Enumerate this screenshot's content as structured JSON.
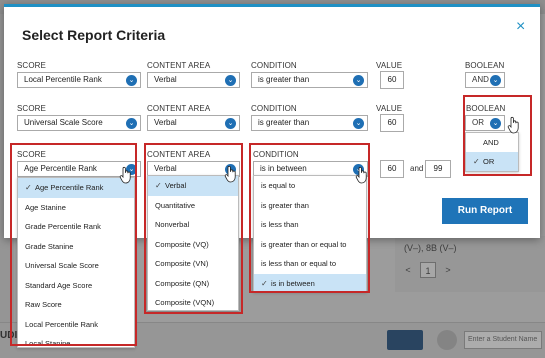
{
  "dialog": {
    "title": "Select Report Criteria",
    "close_glyph": "×",
    "run_button": "Run Report"
  },
  "rows": [
    {
      "score_label": "SCORE",
      "score_value": "Local Percentile Rank",
      "content_label": "CONTENT AREA",
      "content_value": "Verbal",
      "condition_label": "CONDITION",
      "condition_value": "is greater than",
      "value_label": "VALUE",
      "value": "60",
      "boolean_label": "BOOLEAN",
      "boolean_value": "AND"
    },
    {
      "score_label": "SCORE",
      "score_value": "Universal Scale Score",
      "content_label": "CONTENT AREA",
      "content_value": "Verbal",
      "condition_label": "CONDITION",
      "condition_value": "is greater than",
      "value_label": "VALUE",
      "value": "60",
      "boolean_label": "BOOLEAN",
      "boolean_value": "OR"
    },
    {
      "score_label": "SCORE",
      "score_value": "Age Percentile Rank",
      "content_label": "CONTENT AREA",
      "content_value": "Verbal",
      "condition_label": "CONDITION",
      "condition_value": "is in between",
      "value": "60",
      "and_text": "and",
      "value2": "99"
    }
  ],
  "score_options": [
    "Age Percentile Rank",
    "Age Stanine",
    "Grade Percentile Rank",
    "Grade Stanine",
    "Universal Scale Score",
    "Standard Age Score",
    "Raw Score",
    "Local Percentile Rank",
    "Local Stanine"
  ],
  "score_selected": "Age Percentile Rank",
  "content_options": [
    "Verbal",
    "Quantitative",
    "Nonverbal",
    "Composite (VQ)",
    "Composite (VN)",
    "Composite (QN)",
    "Composite (VQN)"
  ],
  "content_selected": "Verbal",
  "condition_options": [
    "is equal to",
    "is greater than",
    "is less than",
    "is greater than or equal to",
    "is less than or equal to",
    "is in between"
  ],
  "condition_selected": "is in between",
  "boolean_options": [
    "AND",
    "OR"
  ],
  "boolean_selected": "OR",
  "checkmark": "✓",
  "chevron_glyph": "⌄",
  "background": {
    "range_text": "(V–), 8B (V–)",
    "pager_prev": "<",
    "pager_page": "1",
    "pager_next": ">",
    "student_placeholder": "Enter a Student Name",
    "student_label": "UDI"
  },
  "colors": {
    "accent": "#1f90c4",
    "button_blue": "#1f74b8",
    "highlight_red": "#c62828",
    "selected_row": "#c9e3f6"
  }
}
